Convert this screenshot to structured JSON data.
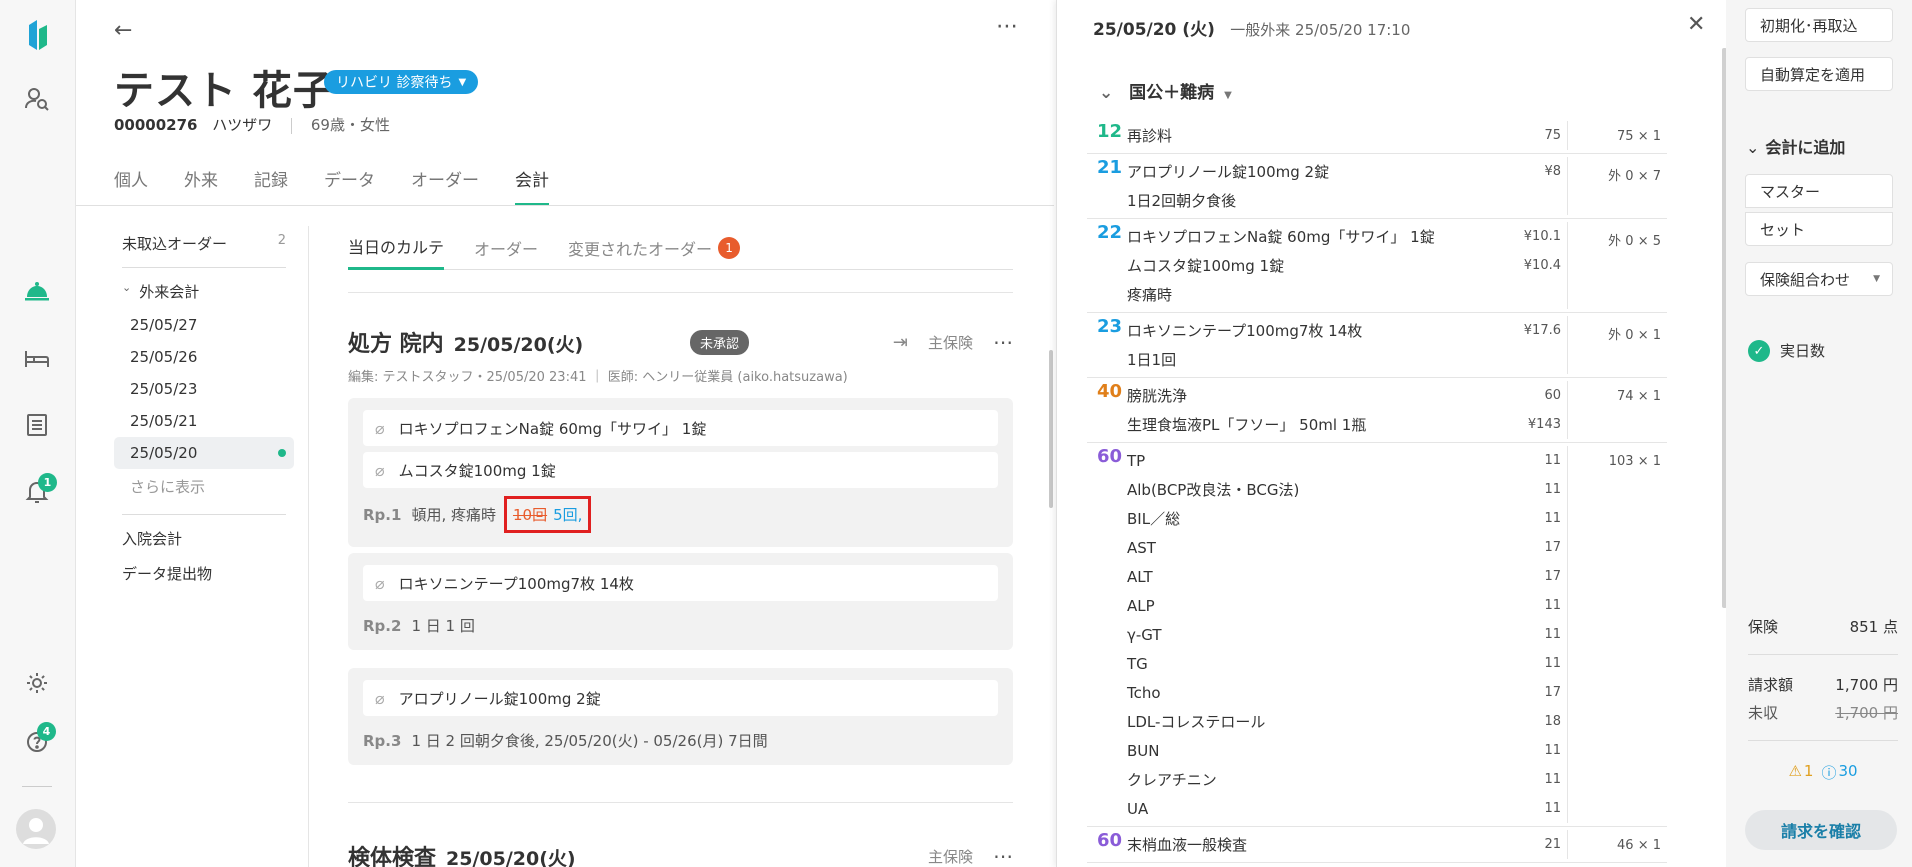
{
  "nav": {
    "help_badge": "4",
    "bell_badge": "1"
  },
  "patient": {
    "name": "テスト 花子",
    "status": "リハビリ 診察待ち",
    "id": "00000276",
    "kana": "ハツザワ",
    "age_sex": "69歳・女性"
  },
  "tabs": [
    "個人",
    "外来",
    "記録",
    "データ",
    "オーダー",
    "会計"
  ],
  "subside": {
    "uncollected_label": "未取込オーダー",
    "uncollected_count": "2",
    "outpatient_label": "外来会計",
    "dates": [
      "25/05/27",
      "25/05/26",
      "25/05/23",
      "25/05/21",
      "25/05/20"
    ],
    "more_label": "さらに表示",
    "inpatient_label": "入院会計",
    "data_submission_label": "データ提出物"
  },
  "karte": {
    "tabs": [
      "当日のカルテ",
      "オーダー",
      "変更されたオーダー"
    ],
    "changed_badge": "1",
    "section_title": "処方 院内",
    "section_date": "25/05/20(火)",
    "status_badge": "未承認",
    "insurance": "主保険",
    "meta": "編集: テストスタッフ・25/05/20 23:41 ｜ 医師: ヘンリー従業員 (aiko.hatsuzawa)",
    "rp1": {
      "drugs": [
        "ロキソプロフェンNa錠 60mg「サワイ」 1錠",
        "ムコスタ錠100mg 1錠"
      ],
      "label": "Rp.1",
      "usage": "頓用, 疼痛時",
      "old_value": "10回",
      "new_value": "5回,"
    },
    "rp2": {
      "drugs": [
        "ロキソニンテープ100mg7枚 14枚"
      ],
      "label": "Rp.2",
      "usage": "1 日 1 回"
    },
    "rp3": {
      "drugs": [
        "アロプリノール錠100mg 2錠"
      ],
      "label": "Rp.3",
      "usage": "1 日 2 回朝夕食後, 25/05/20(火) - 05/26(月) 7日間"
    },
    "next_section_title": "検体検査",
    "next_section_date": "25/05/20(火)",
    "next_insurance": "主保険"
  },
  "billing": {
    "date": "25/05/20 (火)",
    "visit": "一般外来 25/05/20 17:10",
    "insurance_group": "国公＋難病",
    "rows": [
      {
        "code": "12",
        "color": "#1fb88a",
        "items": [
          {
            "name": "再診料",
            "pt": "75"
          }
        ],
        "total": "75 × 1"
      },
      {
        "code": "21",
        "color": "#1a9de0",
        "items": [
          {
            "name": "アロプリノール錠100mg 2錠",
            "pt": "¥8"
          },
          {
            "name": "1日2回朝夕食後",
            "pt": ""
          }
        ],
        "total": "外 0 × 7"
      },
      {
        "code": "22",
        "color": "#1a9de0",
        "items": [
          {
            "name": "ロキソプロフェンNa錠 60mg「サワイ」 1錠",
            "pt": "¥10.1"
          },
          {
            "name": "ムコスタ錠100mg 1錠",
            "pt": "¥10.4"
          },
          {
            "name": "疼痛時",
            "pt": ""
          }
        ],
        "total": "外 0 × 5"
      },
      {
        "code": "23",
        "color": "#1a9de0",
        "items": [
          {
            "name": "ロキソニンテープ100mg7枚 14枚",
            "pt": "¥17.6"
          },
          {
            "name": "1日1回",
            "pt": ""
          }
        ],
        "total": "外 0 × 1"
      },
      {
        "code": "40",
        "color": "#e07f1a",
        "items": [
          {
            "name": "膀胱洗浄",
            "pt": "60"
          },
          {
            "name": "生理食塩液PL「フソー」 50ml 1瓶",
            "pt": "¥143"
          }
        ],
        "total": "74 × 1"
      },
      {
        "code": "60",
        "color": "#8a5cd8",
        "items": [
          {
            "name": "TP",
            "pt": "11"
          },
          {
            "name": "Alb(BCP改良法・BCG法)",
            "pt": "11"
          },
          {
            "name": "BIL／総",
            "pt": "11"
          },
          {
            "name": "AST",
            "pt": "17"
          },
          {
            "name": "ALT",
            "pt": "17"
          },
          {
            "name": "ALP",
            "pt": "11"
          },
          {
            "name": "γ-GT",
            "pt": "11"
          },
          {
            "name": "TG",
            "pt": "11"
          },
          {
            "name": "Tcho",
            "pt": "17"
          },
          {
            "name": "LDL-コレステロール",
            "pt": "18"
          },
          {
            "name": "BUN",
            "pt": "11"
          },
          {
            "name": "クレアチニン",
            "pt": "11"
          },
          {
            "name": "UA",
            "pt": "11"
          }
        ],
        "total": "103 × 1"
      },
      {
        "code": "60",
        "color": "#8a5cd8",
        "items": [
          {
            "name": "末梢血液一般検査",
            "pt": "21"
          }
        ],
        "total": "46 × 1"
      }
    ]
  },
  "right": {
    "btn_reset": "初期化･再取込",
    "btn_auto": "自動算定を適用",
    "add_section": "会計に追加",
    "btn_master": "マスター",
    "btn_set": "セット",
    "btn_ins": "保険組合わせ",
    "actual_days": "実日数",
    "ins_label": "保険",
    "ins_value": "851 点",
    "billed_label": "請求額",
    "billed_value": "1,700 円",
    "unpaid_label": "未収",
    "unpaid_value": "1,700 円",
    "warn_count": "1",
    "info_count": "30",
    "confirm_btn": "請求を確認"
  }
}
